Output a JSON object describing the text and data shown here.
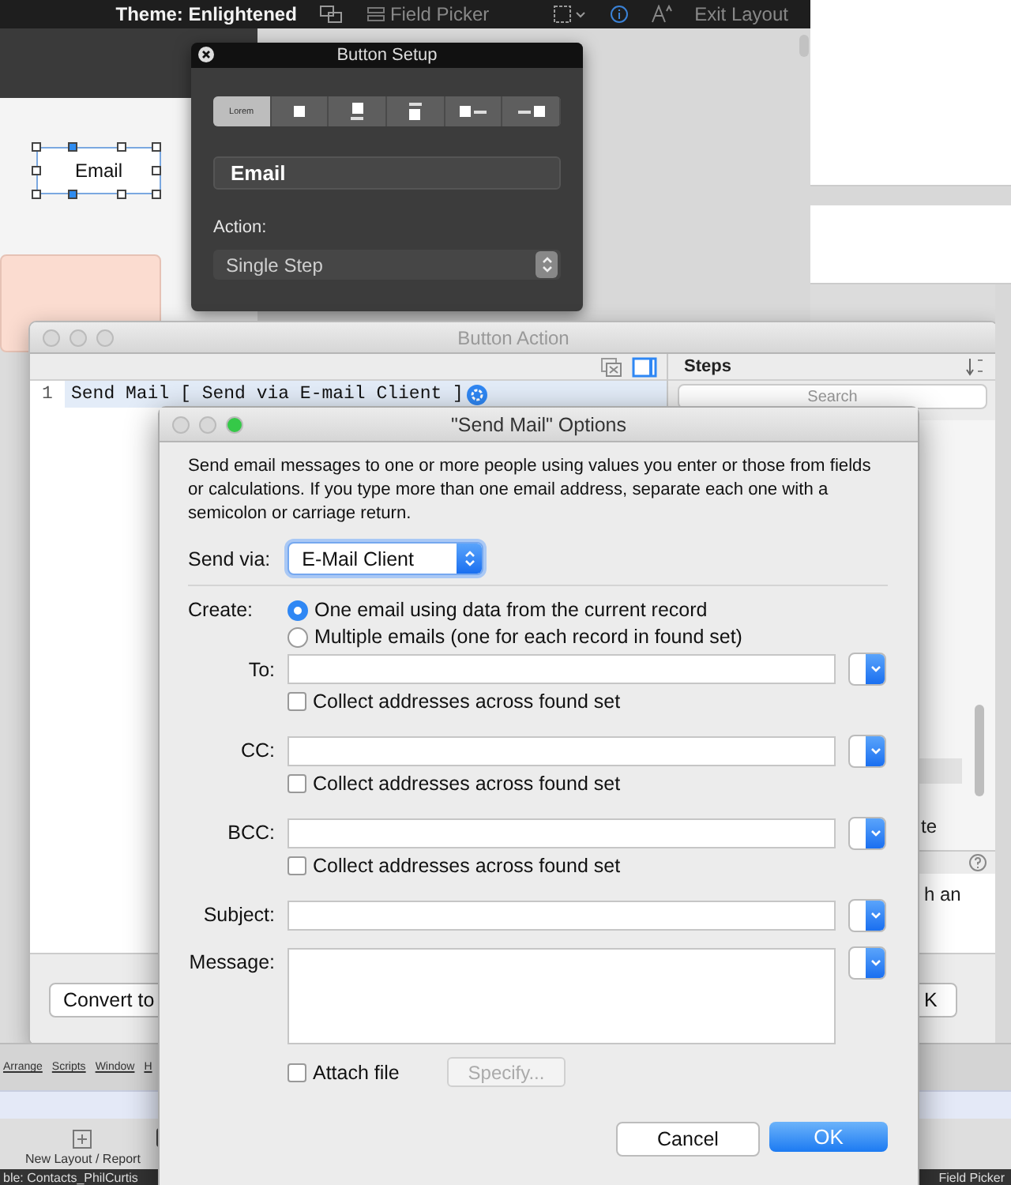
{
  "toolbar": {
    "theme": "Theme: Enlightened",
    "field_picker": "Field Picker",
    "exit": "Exit Layout"
  },
  "canvas": {
    "button_label": "Email"
  },
  "button_setup": {
    "title": "Button Setup",
    "segments": [
      {
        "kind": "text",
        "label": "Lorem",
        "selected": true
      },
      {
        "kind": "icon",
        "selected": false
      },
      {
        "kind": "icon-over-text",
        "selected": false
      },
      {
        "kind": "text-over-icon",
        "selected": false
      },
      {
        "kind": "icon-left",
        "selected": false
      },
      {
        "kind": "icon-right",
        "selected": false
      }
    ],
    "name": "Email",
    "action_label": "Action:",
    "action": "Single Step"
  },
  "button_action": {
    "title": "Button Action",
    "lines": [
      {
        "number": "1",
        "text": "Send Mail [ Send via E-mail Client ]",
        "selected": true
      }
    ],
    "steps_title": "Steps",
    "search_placeholder": "Search",
    "steps_fragment": "te",
    "help_fragment": "h an",
    "convert_button": "Convert to",
    "ok_fragment": "K"
  },
  "app": {
    "menus": [
      "Arrange",
      "Scripts",
      "Window",
      "H"
    ],
    "new_layout": "New Layout / Report",
    "status_left": "ble: Contacts_PhilCurtis",
    "status_right": "Field Picker"
  },
  "dialog": {
    "title": "\"Send Mail\" Options",
    "description": "Send email messages to one or more people using values you enter or those from fields or calculations. If you type more than one email address, separate each one with a semicolon or carriage return.",
    "send_via_label": "Send via:",
    "send_via": "E-Mail Client",
    "create_label": "Create:",
    "create_options": [
      {
        "label": "One email using data from the current record",
        "selected": true
      },
      {
        "label": "Multiple emails (one for each record in found set)",
        "selected": false
      }
    ],
    "address_fields": [
      {
        "label": "To:",
        "collect": "Collect addresses across found set",
        "checked": false
      },
      {
        "label": "CC:",
        "collect": "Collect addresses across found set",
        "checked": false
      },
      {
        "label": "BCC:",
        "collect": "Collect addresses across found set",
        "checked": false
      }
    ],
    "subject_label": "Subject:",
    "message_label": "Message:",
    "attach": {
      "label": "Attach file",
      "checked": false
    },
    "specify": "Specify...",
    "cancel": "Cancel",
    "ok": "OK"
  }
}
